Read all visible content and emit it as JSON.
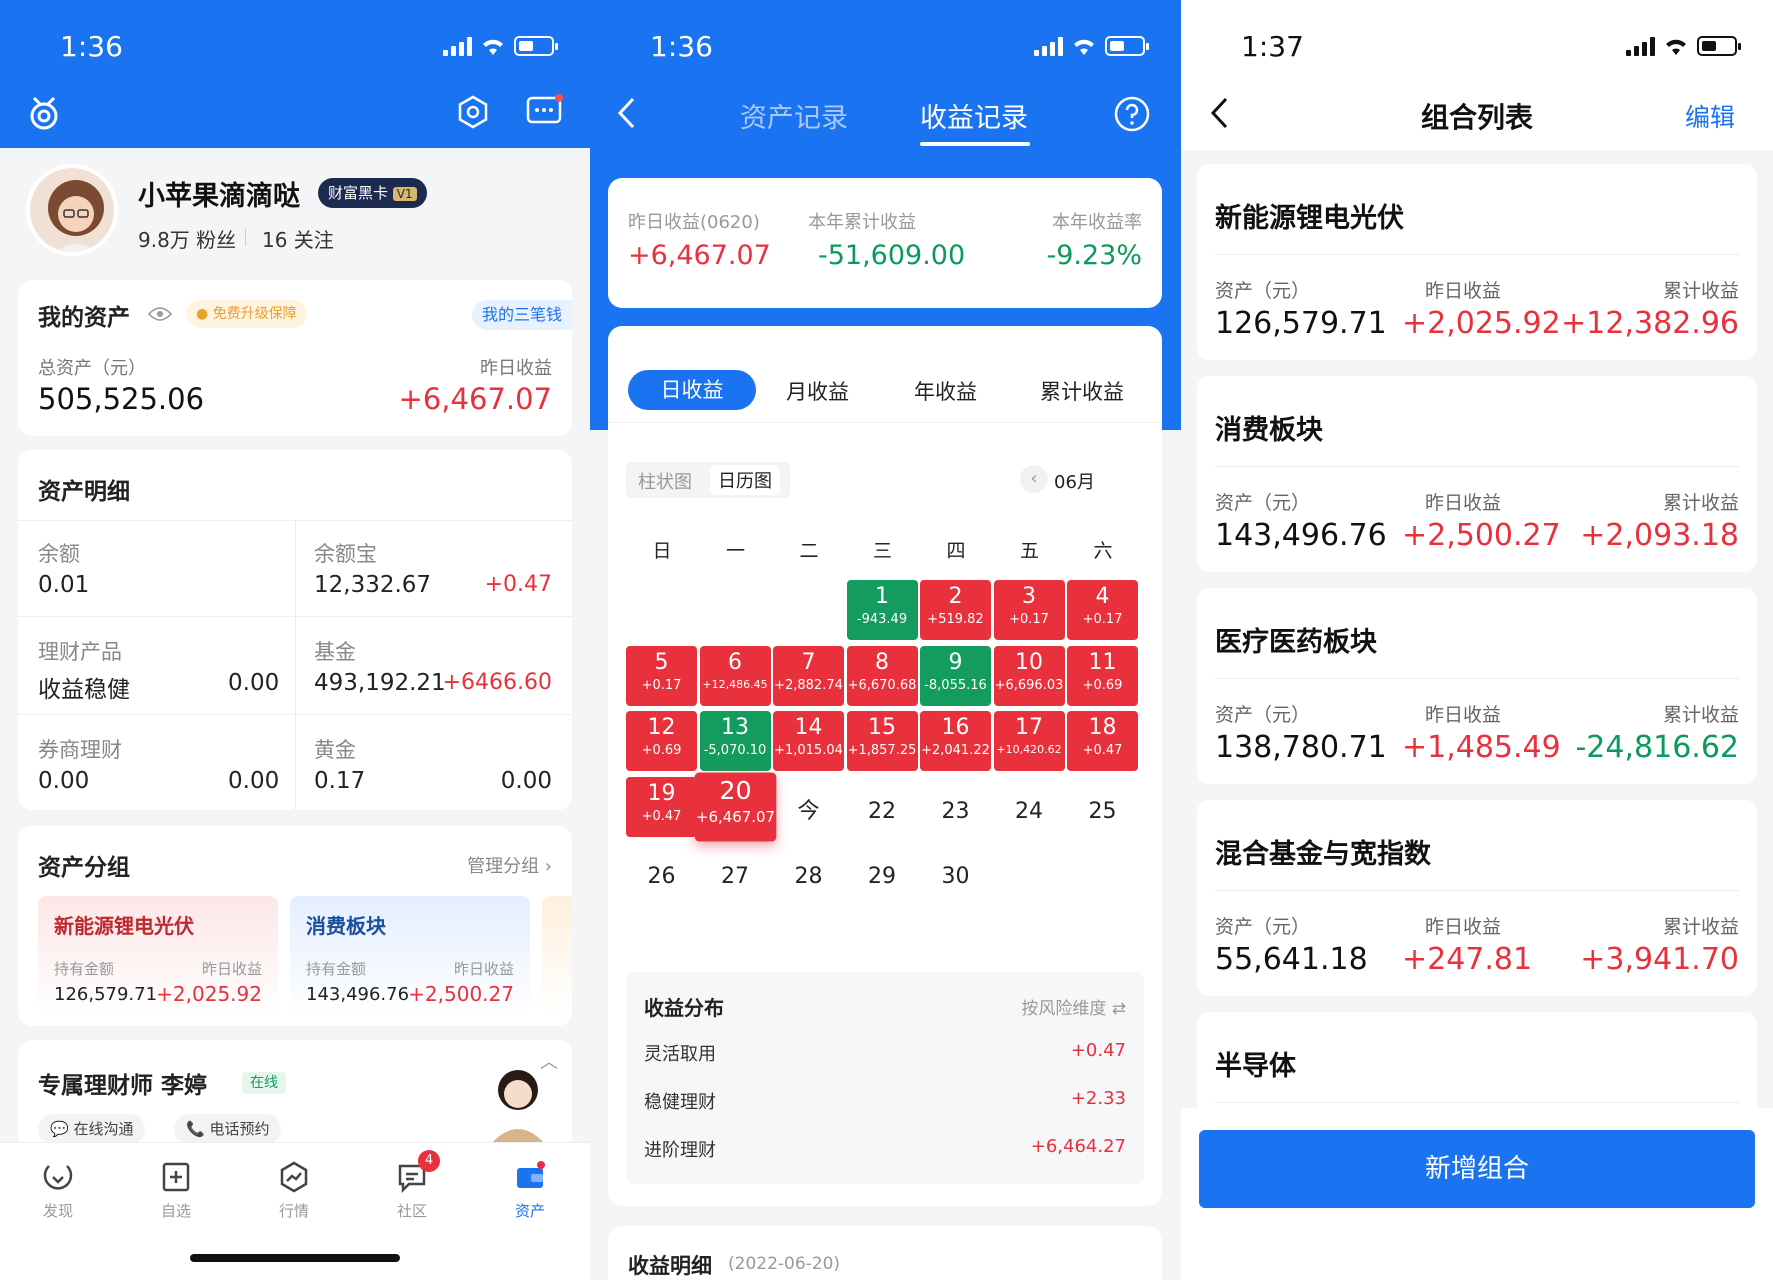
{
  "p1": {
    "time": "1:36",
    "username": "小苹果滴滴哒",
    "badge": "财富黑卡",
    "badge_level": "V1",
    "followers": "9.8万 粉丝",
    "following": "16 关注",
    "my_assets": {
      "title": "我的资产",
      "upgrade": "免费升级保障",
      "link": "我的三笔钱",
      "total_label": "总资产（元）",
      "total": "505,525.06",
      "yesterday_label": "昨日收益",
      "yesterday": "+6,467.07"
    },
    "detail": {
      "title": "资产明细",
      "items": [
        {
          "label": "余额",
          "v1": "0.01",
          "v2": ""
        },
        {
          "label": "余额宝",
          "v1": "12,332.67",
          "v2": "+0.47"
        },
        {
          "label": "理财产品",
          "v1": "收益稳健",
          "v2": "0.00"
        },
        {
          "label": "基金",
          "v1": "493,192.21",
          "v2": "+6466.60"
        },
        {
          "label": "券商理财",
          "v1": "0.00",
          "v2": "0.00"
        },
        {
          "label": "黄金",
          "v1": "0.17",
          "v2": "0.00"
        }
      ]
    },
    "groups": {
      "title": "资产分组",
      "manage": "管理分组",
      "cards": [
        {
          "name": "新能源锂电光伏",
          "hold_label": "持有金额",
          "hold": "126,579.71",
          "y_label": "昨日收益",
          "y": "+2,025.92"
        },
        {
          "name": "消费板块",
          "hold_label": "持有金额",
          "hold": "143,496.76",
          "y_label": "昨日收益",
          "y": "+2,500.27"
        }
      ]
    },
    "advisor": {
      "title": "专属理财师 李婷",
      "status": "在线",
      "chat": "在线沟通",
      "phone": "电话预约"
    },
    "nav": [
      {
        "label": "发现"
      },
      {
        "label": "自选"
      },
      {
        "label": "行情"
      },
      {
        "label": "社区",
        "badge": "4"
      },
      {
        "label": "资产"
      }
    ]
  },
  "p2": {
    "time": "1:36",
    "tabs": [
      "资产记录",
      "收益记录"
    ],
    "summary": [
      {
        "label": "昨日收益(0620)",
        "value": "+6,467.07"
      },
      {
        "label": "本年累计收益",
        "value": "-51,609.00"
      },
      {
        "label": "本年收益率",
        "value": "-9.23%"
      }
    ],
    "period_tabs": [
      "日收益",
      "月收益",
      "年收益",
      "累计收益"
    ],
    "view_tabs": [
      "柱状图",
      "日历图"
    ],
    "month": "06月",
    "weekdays": [
      "日",
      "一",
      "二",
      "三",
      "四",
      "五",
      "六"
    ],
    "calendar": [
      {
        "d": "1",
        "v": "-943.49",
        "c": "g"
      },
      {
        "d": "2",
        "v": "+519.82",
        "c": "r"
      },
      {
        "d": "3",
        "v": "+0.17",
        "c": "r"
      },
      {
        "d": "4",
        "v": "+0.17",
        "c": "r"
      },
      {
        "d": "5",
        "v": "+0.17",
        "c": "r"
      },
      {
        "d": "6",
        "v": "+12,486.45",
        "c": "r"
      },
      {
        "d": "7",
        "v": "+2,882.74",
        "c": "r"
      },
      {
        "d": "8",
        "v": "+6,670.68",
        "c": "r"
      },
      {
        "d": "9",
        "v": "-8,055.16",
        "c": "g"
      },
      {
        "d": "10",
        "v": "+6,696.03",
        "c": "r"
      },
      {
        "d": "11",
        "v": "+0.69",
        "c": "r"
      },
      {
        "d": "12",
        "v": "+0.69",
        "c": "r"
      },
      {
        "d": "13",
        "v": "-5,070.10",
        "c": "g"
      },
      {
        "d": "14",
        "v": "+1,015.04",
        "c": "r"
      },
      {
        "d": "15",
        "v": "+1,857.25",
        "c": "r"
      },
      {
        "d": "16",
        "v": "+2,041.22",
        "c": "r"
      },
      {
        "d": "17",
        "v": "+10,420.62",
        "c": "r"
      },
      {
        "d": "18",
        "v": "+0.47",
        "c": "r"
      },
      {
        "d": "19",
        "v": "+0.47",
        "c": "r"
      },
      {
        "d": "20",
        "v": "+6,467.07",
        "c": "r"
      },
      {
        "d": "今",
        "v": "",
        "c": "p"
      },
      {
        "d": "22",
        "v": "",
        "c": "p"
      },
      {
        "d": "23",
        "v": "",
        "c": "p"
      },
      {
        "d": "24",
        "v": "",
        "c": "p"
      },
      {
        "d": "25",
        "v": "",
        "c": "p"
      },
      {
        "d": "26",
        "v": "",
        "c": "p"
      },
      {
        "d": "27",
        "v": "",
        "c": "p"
      },
      {
        "d": "28",
        "v": "",
        "c": "p"
      },
      {
        "d": "29",
        "v": "",
        "c": "p"
      },
      {
        "d": "30",
        "v": "",
        "c": "p"
      }
    ],
    "dist": {
      "title": "收益分布",
      "dim": "按风险维度",
      "rows": [
        {
          "label": "灵活取用",
          "value": "+0.47"
        },
        {
          "label": "稳健理财",
          "value": "+2.33"
        },
        {
          "label": "进阶理财",
          "value": "+6,464.27"
        }
      ]
    },
    "detail_title": "收益明细",
    "detail_date": "(2022-06-20)"
  },
  "p3": {
    "time": "1:37",
    "title": "组合列表",
    "edit": "编辑",
    "groups": [
      {
        "name": "新能源锂电光伏",
        "a_label": "资产（元）",
        "asset": "126,579.71",
        "y_label": "昨日收益",
        "y": "+2,025.92",
        "c_label": "累计收益",
        "c": "+12,382.96",
        "cc": "red"
      },
      {
        "name": "消费板块",
        "a_label": "资产（元）",
        "asset": "143,496.76",
        "y_label": "昨日收益",
        "y": "+2,500.27",
        "c_label": "累计收益",
        "c": "+2,093.18",
        "cc": "red"
      },
      {
        "name": "医疗医药板块",
        "a_label": "资产（元）",
        "asset": "138,780.71",
        "y_label": "昨日收益",
        "y": "+1,485.49",
        "c_label": "累计收益",
        "c": "-24,816.62",
        "cc": "green"
      },
      {
        "name": "混合基金与宽指数",
        "a_label": "资产（元）",
        "asset": "55,641.18",
        "y_label": "昨日收益",
        "y": "+247.81",
        "c_label": "累计收益",
        "c": "+3,941.70",
        "cc": "red"
      }
    ],
    "last_group": "半导体",
    "add_button": "新增组合"
  },
  "colors": {
    "blue": "#1a73f0",
    "red": "#e8313c",
    "green": "#149c5f"
  }
}
